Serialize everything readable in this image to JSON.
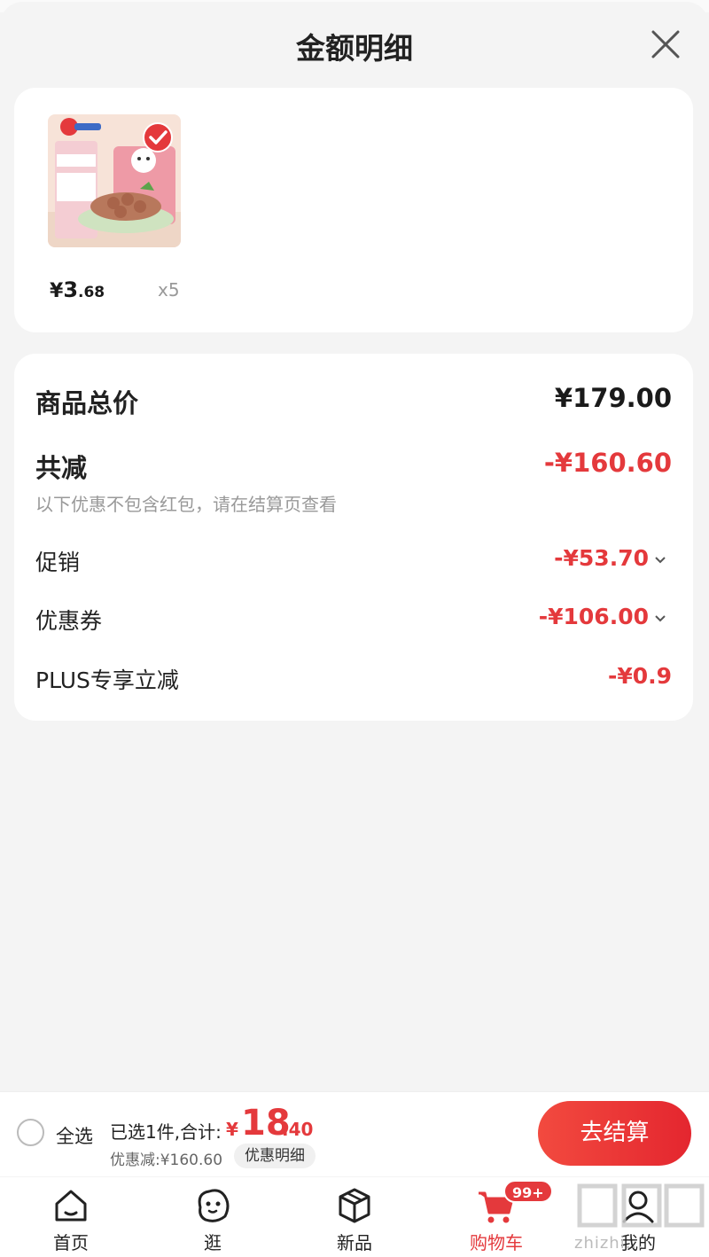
{
  "header": {
    "title": "金额明细"
  },
  "product": {
    "price_yen": "¥",
    "price_int": "3",
    "price_dec": ".68",
    "quantity": "x5"
  },
  "summary": {
    "total_label": "商品总价",
    "total_value": "¥179.00",
    "reduction_label": "共减",
    "reduction_value": "-¥160.60",
    "note": "以下优惠不包含红包，请在结算页查看",
    "rows": [
      {
        "label": "促销",
        "value": "-¥53.70"
      },
      {
        "label": "优惠券",
        "value": "-¥106.00"
      },
      {
        "label": "PLUS专享立减",
        "value": "-¥0.9"
      }
    ]
  },
  "bottom_bar": {
    "select_all": "全选",
    "selected_text": "已选1件,合计:",
    "total_yen": "¥",
    "total_int": "18",
    "total_dec": ".40",
    "saved": "优惠减:¥160.60",
    "detail_button": "优惠明细",
    "checkout_button": "去结算"
  },
  "tabbar": {
    "tabs": [
      {
        "label": "首页",
        "icon": "home-icon"
      },
      {
        "label": "逛",
        "icon": "face-icon"
      },
      {
        "label": "新品",
        "icon": "cube-icon"
      },
      {
        "label": "购物车",
        "icon": "cart-icon",
        "badge": "99+"
      },
      {
        "label": "我的",
        "icon": "profile-icon"
      }
    ]
  },
  "watermark": "zhizhi...",
  "colors": {
    "accent": "#e4393c",
    "background": "#f4f4f4"
  }
}
